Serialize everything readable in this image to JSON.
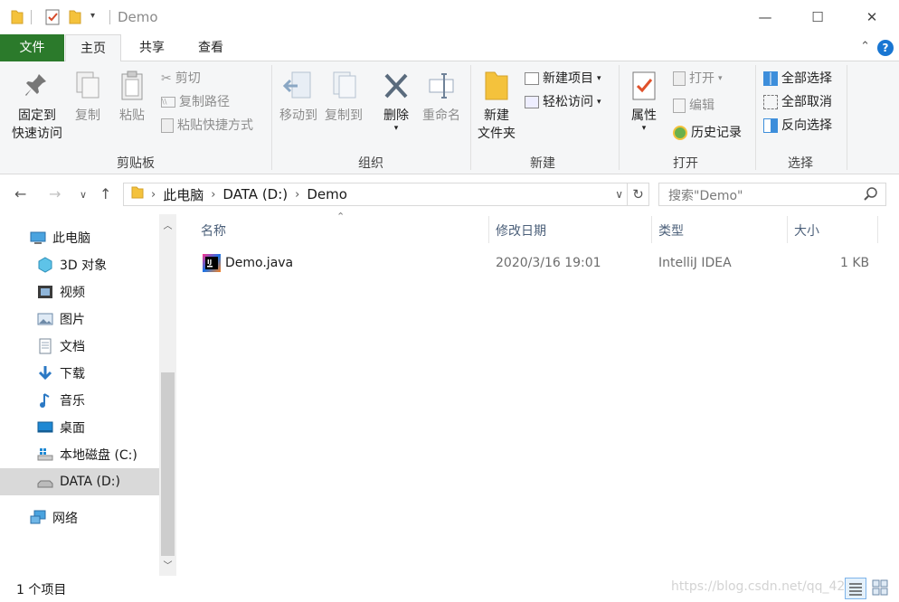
{
  "window": {
    "title": "Demo",
    "minimize": "—",
    "maximize": "☐",
    "close": "✕"
  },
  "tabs": {
    "file": "文件",
    "home": "主页",
    "share": "共享",
    "view": "查看",
    "help": "?"
  },
  "ribbon": {
    "clipboard": {
      "label": "剪贴板",
      "pin": [
        "固定到",
        "快速访问"
      ],
      "copy": "复制",
      "paste": "粘贴",
      "cut": "剪切",
      "copy_path": "复制路径",
      "paste_shortcut": "粘贴快捷方式"
    },
    "organize": {
      "label": "组织",
      "move_to": "移动到",
      "copy_to": "复制到",
      "delete": "删除",
      "rename": "重命名"
    },
    "new": {
      "label": "新建",
      "new_folder": [
        "新建",
        "文件夹"
      ],
      "new_item": "新建项目",
      "easy_access": "轻松访问"
    },
    "open": {
      "label": "打开",
      "properties": "属性",
      "open": "打开",
      "edit": "编辑",
      "history": "历史记录"
    },
    "select": {
      "label": "选择",
      "select_all": "全部选择",
      "select_none": "全部取消",
      "invert": "反向选择"
    }
  },
  "address": {
    "crumbs": [
      "此电脑",
      "DATA (D:)",
      "Demo"
    ],
    "search_placeholder": "搜索\"Demo\""
  },
  "nav_pane": {
    "items": [
      {
        "label": "此电脑",
        "icon": "pc-icon"
      },
      {
        "label": "3D 对象",
        "icon": "3d-objects-icon"
      },
      {
        "label": "视频",
        "icon": "videos-icon"
      },
      {
        "label": "图片",
        "icon": "pictures-icon"
      },
      {
        "label": "文档",
        "icon": "documents-icon"
      },
      {
        "label": "下载",
        "icon": "downloads-icon"
      },
      {
        "label": "音乐",
        "icon": "music-icon"
      },
      {
        "label": "桌面",
        "icon": "desktop-icon"
      },
      {
        "label": "本地磁盘 (C:)",
        "icon": "windows-drive-icon"
      },
      {
        "label": "DATA (D:)",
        "icon": "drive-icon"
      },
      {
        "label": "网络",
        "icon": "network-icon"
      }
    ]
  },
  "file_list": {
    "columns": [
      "名称",
      "修改日期",
      "类型",
      "大小"
    ],
    "rows": [
      {
        "name": "Demo.java",
        "modified": "2020/3/16 19:01",
        "type": "IntelliJ IDEA",
        "size": "1 KB"
      }
    ]
  },
  "status": {
    "item_count": "1 个项目",
    "watermark": "https://blog.csdn.net/qq_42..."
  },
  "colors": {
    "file_tab": "#2b7a2b",
    "accent": "#1976d2",
    "folder": "#f4c23c",
    "selected_nav": "#d9d9d9"
  }
}
